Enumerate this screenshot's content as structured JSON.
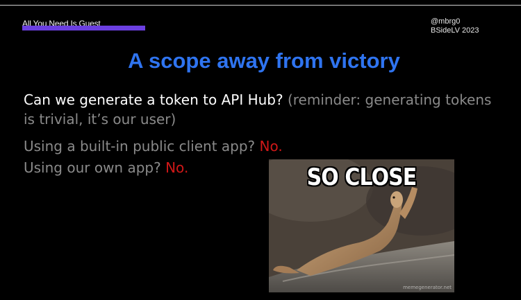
{
  "slide": {
    "title": "All You Need Is Guest",
    "author": "@mbrg0",
    "event": "BSideLV 2023",
    "headline": "A scope away from victory"
  },
  "content": {
    "q1_text": "Can we generate a token to API Hub? ",
    "q1_note": "(reminder: generating tokens is trivial, it’s our user)",
    "q2_text": "Using a built-in public client app? ",
    "q2_answer": "No.",
    "q3_text": "Using our own app? ",
    "q3_answer": "No."
  },
  "meme": {
    "caption": "SO CLOSE",
    "watermark": "memegenerator.net",
    "subject": "prairie dog reaching up"
  },
  "colors": {
    "background": "#000000",
    "accent_bar": "#6b3fe0",
    "headline": "#2f74f0",
    "muted_text": "#8a8a8a",
    "answer_red": "#d01818"
  }
}
